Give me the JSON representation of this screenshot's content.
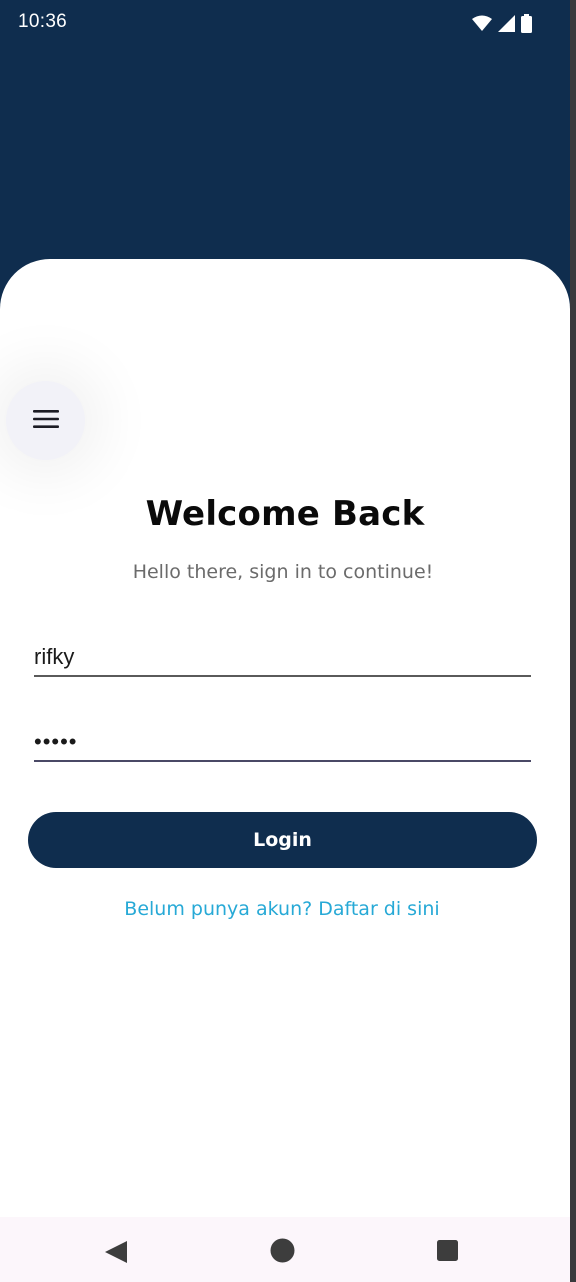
{
  "status_bar": {
    "time": "10:36",
    "icons": [
      "wifi-icon",
      "cellular-signal-icon",
      "battery-icon"
    ]
  },
  "colors": {
    "header_bg": "#0f2d4e",
    "card_bg": "#ffffff",
    "primary_button": "#0f2d4e",
    "link": "#27a9d6",
    "subtitle": "#6b6b6b"
  },
  "menu": {
    "icon": "hamburger-menu-icon"
  },
  "login": {
    "title": "Welcome Back",
    "subtitle": "Hello there, sign in to continue!",
    "username_value": "rifky",
    "password_value": "•••••",
    "button_label": "Login",
    "register_link": "Belum punya akun? Daftar di sini"
  },
  "nav_bar": {
    "buttons": [
      "back-icon",
      "home-icon",
      "recent-apps-icon"
    ]
  }
}
